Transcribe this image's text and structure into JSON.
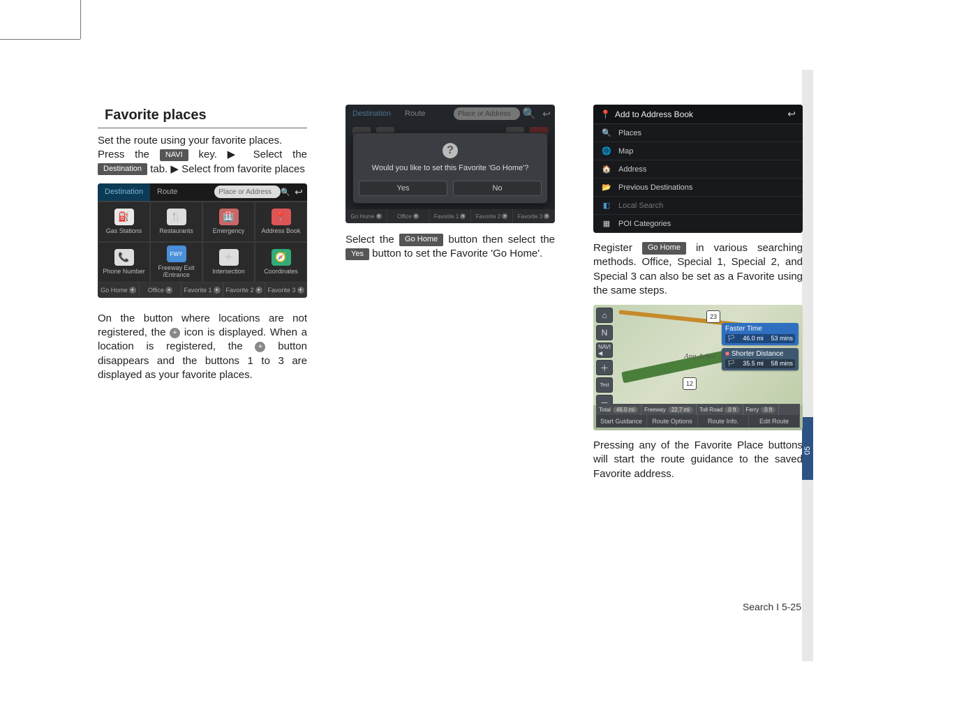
{
  "section_title": "Favorite places",
  "col1": {
    "p1a": "Set the route using your favorite places.",
    "p1b_pre": "Press the ",
    "btn_navi": "NAVI",
    "p1b_mid": " key. ▶ Select the ",
    "btn_dest": "Destination",
    "p1b_post": " tab. ▶ Select from favorite places",
    "p2": "On the button where locations are not registered, the ",
    "plus1": "+",
    "p2b": " icon is displayed. When a location is registered, the ",
    "plus2": "+",
    "p2c": " button disappears and the buttons 1 to 3 are displayed as your  favorite places."
  },
  "shot1": {
    "tab_dest": "Destination",
    "tab_route": "Route",
    "search_ph": "Place or Address",
    "cells": [
      {
        "label": "Gas Stations"
      },
      {
        "label": "Restaurants"
      },
      {
        "label": "Emergency"
      },
      {
        "label": "Address Book"
      },
      {
        "label": "Phone Number"
      },
      {
        "label": "Freeway Exit /Entrance"
      },
      {
        "label": "Intersection"
      },
      {
        "label": "Coordinates"
      }
    ],
    "favs": [
      "Go Home",
      "Office",
      "Favorite 1",
      "Favorite 2",
      "Favorite 3"
    ]
  },
  "col2": {
    "p1a": "Select the ",
    "btn_gohome": "Go Home",
    "p1b": " button then select the ",
    "btn_yes": "Yes",
    "p1c": " button to set the Favorite 'Go Home'."
  },
  "shot2": {
    "tab_dest": "Destination",
    "tab_route": "Route",
    "search_ph": "Place or Address",
    "msg": "Would you like to set this Favorite 'Go Home'?",
    "yes": "Yes",
    "no": "No",
    "favs": [
      "Go Home",
      "Office",
      "Favorite 1",
      "Favorite 2",
      "Favorite 3"
    ]
  },
  "col3": {
    "p1a": "Register ",
    "btn_gohome": "Go Home",
    "p1b": " in various searching methods. Office, Special 1, Special 2, and Special 3 can also be set as a Favorite using the same steps.",
    "p2": "Pressing any of the Favorite Place buttons will start the route guidance to the saved Favorite address."
  },
  "shot3": {
    "title": "Add to Address Book",
    "items": [
      {
        "icon": "🔍",
        "color": "#d55",
        "label": "Places"
      },
      {
        "icon": "🌐",
        "color": "#5a9",
        "label": "Map"
      },
      {
        "icon": "🏠",
        "color": "#ccc",
        "label": "Address"
      },
      {
        "icon": "📂",
        "color": "#c93",
        "label": "Previous Destinations"
      },
      {
        "icon": "◧",
        "color": "#49c",
        "label": "Local Search",
        "dim": true
      },
      {
        "icon": "▦",
        "color": "#ccc",
        "label": "POI Categories"
      }
    ]
  },
  "shot4": {
    "map_label": "Ann Arbor",
    "shield1": "23",
    "shield2": "12",
    "opt1": {
      "title": "Faster Time",
      "dist": "46.0 mi",
      "time": "53 mins"
    },
    "opt2": {
      "title": "Shorter Distance",
      "dist": "35.5 mi",
      "time": "58 mins"
    },
    "summary": {
      "total_lbl": "Total",
      "total_val": "46.0 mi",
      "fwy_lbl": "Freeway",
      "fwy_val": "22.7 mi",
      "toll_lbl": "Toll Road",
      "toll_val": "0 ft",
      "ferry_lbl": "Ferry",
      "ferry_val": "0 ft"
    },
    "bbar": [
      "Start Guidance",
      "Route Options",
      "Route Info.",
      "Edit Route"
    ]
  },
  "footer": "Search I 5-25",
  "sidetab_num": "05"
}
